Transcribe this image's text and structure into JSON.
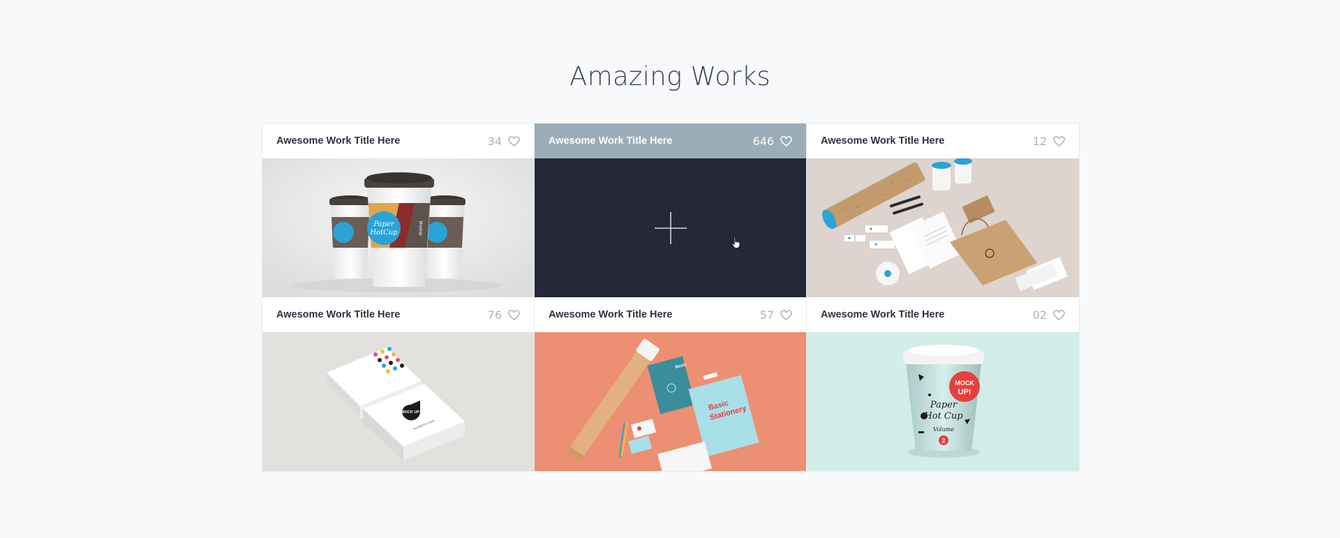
{
  "section": {
    "title": "Amazing Works"
  },
  "works": [
    {
      "title": "Awesome Work Title Here",
      "likes": "34",
      "image": "coffee-cups-mockup"
    },
    {
      "title": "Awesome Work Title Here",
      "likes": "646",
      "image": "hover-overlay",
      "active": true
    },
    {
      "title": "Awesome Work Title Here",
      "likes": "12",
      "image": "kraft-stationery-mockup"
    },
    {
      "title": "Awesome Work Title Here",
      "likes": "76",
      "image": "business-cards-mockup"
    },
    {
      "title": "Awesome Work Title Here",
      "likes": "57",
      "image": "basic-stationery-mockup"
    },
    {
      "title": "Awesome Work Title Here",
      "likes": "02",
      "image": "paper-hot-cup-mockup"
    }
  ],
  "image_labels": {
    "cup_brand_1": "Paper",
    "cup_brand_2": "HotCup",
    "cup_side": "Mockup",
    "mock_1": "MOCK",
    "mock_2": "UP!",
    "hot_cup_1": "Paper",
    "hot_cup_2": "Hot Cup",
    "volume": "Volume",
    "volume_no": "2",
    "stationery_1": "Basic",
    "stationery_2": "Stationery",
    "card_mock": "MOCK UP",
    "card_sub": "BUSINESS CARD"
  },
  "colors": {
    "background": "#f8f9fb",
    "active_header": "#9aadb9",
    "overlay": "#242838",
    "accent_blue": "#2aa3d6",
    "accent_red": "#e6403d",
    "muted": "#a8b4bf"
  },
  "icons": {
    "like": "heart-icon",
    "open": "plus-icon",
    "cursor": "hand-cursor-icon"
  }
}
